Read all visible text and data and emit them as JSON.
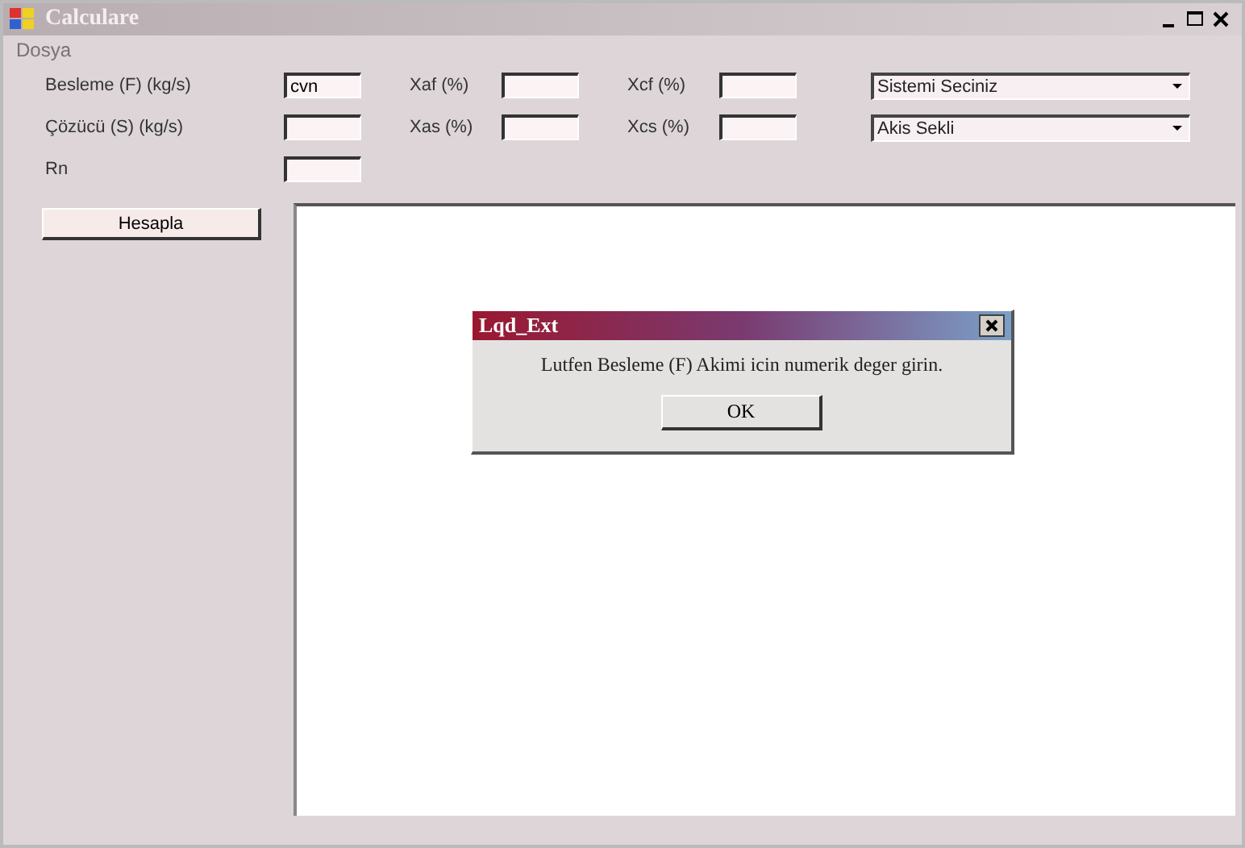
{
  "window": {
    "title": "Calculare"
  },
  "menu": [
    "Dosya"
  ],
  "fields": [
    {
      "label": "Besleme (F) (kg/s)",
      "value": "cvn"
    },
    {
      "label": "Xaf (%)"
    },
    {
      "label": "Xcf (%)"
    },
    {
      "label": "Çözücü (S) (kg/s)"
    },
    {
      "label": "Xas (%)"
    },
    {
      "label": "Xcs (%)"
    },
    {
      "label": "Rn"
    }
  ],
  "dropdowns": [
    {
      "value": "Sistemi Seciniz"
    },
    {
      "value": "Akis Sekli"
    }
  ],
  "calculate_button": "Hesapla",
  "dialog": {
    "title": "Lqd_Ext",
    "message": "Lutfen Besleme (F) Akimi icin numerik deger girin.",
    "button": "OK"
  }
}
